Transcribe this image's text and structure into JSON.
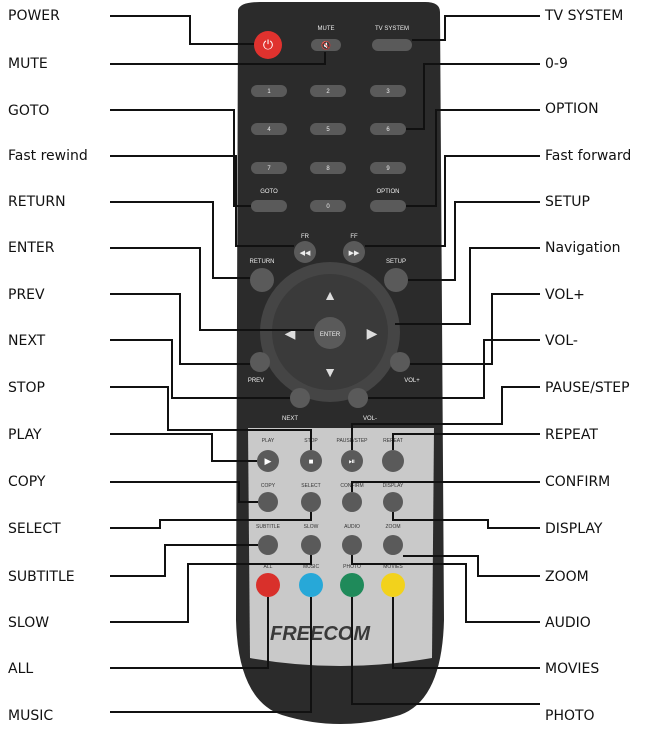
{
  "left_labels": [
    "POWER",
    "MUTE",
    "GOTO",
    "Fast rewind",
    "RETURN",
    "ENTER",
    "PREV",
    "NEXT",
    "STOP",
    "PLAY",
    "COPY",
    "SELECT",
    "SUBTITLE",
    "SLOW",
    "ALL",
    "MUSIC"
  ],
  "right_labels": [
    "TV SYSTEM",
    "0-9",
    "OPTION",
    "Fast forward",
    "SETUP",
    "Navigation",
    "VOL+",
    "VOL-",
    "PAUSE/STEP",
    "REPEAT",
    "CONFIRM",
    "DISPLAY",
    "ZOOM",
    "AUDIO",
    "MOVIES",
    "PHOTO"
  ],
  "remote": {
    "top_labels": {
      "mute": "MUTE",
      "tv_system": "TV SYSTEM"
    },
    "digits": [
      "1",
      "2",
      "3",
      "4",
      "5",
      "6",
      "7",
      "8",
      "9",
      "0"
    ],
    "goto": "GOTO",
    "option": "OPTION",
    "fr": "FR",
    "ff": "FF",
    "return": "RETURN",
    "setup": "SETUP",
    "enter": "ENTER",
    "prev": "PREV",
    "next": "NEXT",
    "vol_plus": "VOL+",
    "vol_minus": "VOL-",
    "play": "PLAY",
    "stop": "STOP",
    "pause_step": "PAUSE/STEP",
    "repeat": "REPEAT",
    "copy": "COPY",
    "select": "SELECT",
    "confirm": "CONFIRM",
    "display": "DISPLAY",
    "subtitle": "SUBTITLE",
    "slow": "SLOW",
    "audio": "AUDIO",
    "zoom": "ZOOM",
    "all": "ALL",
    "music": "MUSIC",
    "photo": "PHOTO",
    "movies": "MOVIES",
    "brand": "FREECOM"
  },
  "colors": {
    "body": "#2b2b2b",
    "button": "#5a5a5a",
    "power": "#e0322e",
    "panel": "#c9c9c9",
    "all": "#d9302b",
    "music": "#27a8d8",
    "photo": "#1f8a5a",
    "movies": "#f2d21c",
    "line": "#111111"
  }
}
